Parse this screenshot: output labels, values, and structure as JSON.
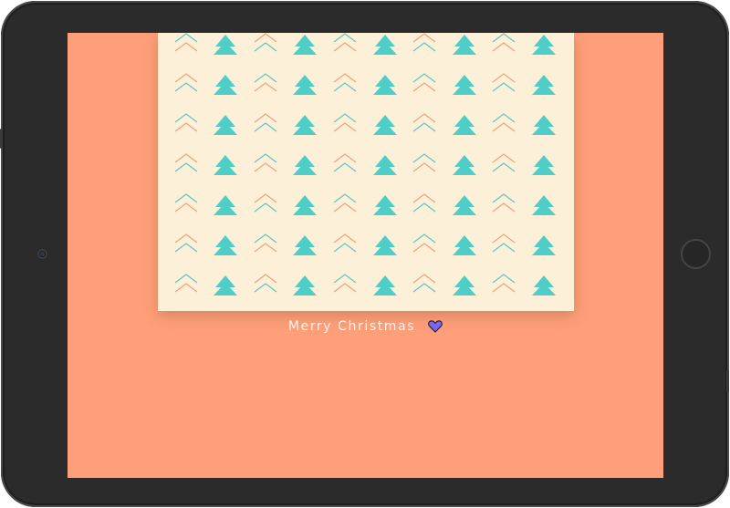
{
  "caption": {
    "text": "Merry Christmas",
    "heart_icon": "purple-heart"
  },
  "colors": {
    "device_frame": "#2b2b2b",
    "screen_background": "#fe9f79",
    "card_background": "#fdf0d8",
    "tree": "#4ecec6",
    "chevron_teal": "#5dc7c2",
    "chevron_orange": "#f3a07e",
    "caption_text": "#fff4ea",
    "heart": "#7b67e9"
  }
}
